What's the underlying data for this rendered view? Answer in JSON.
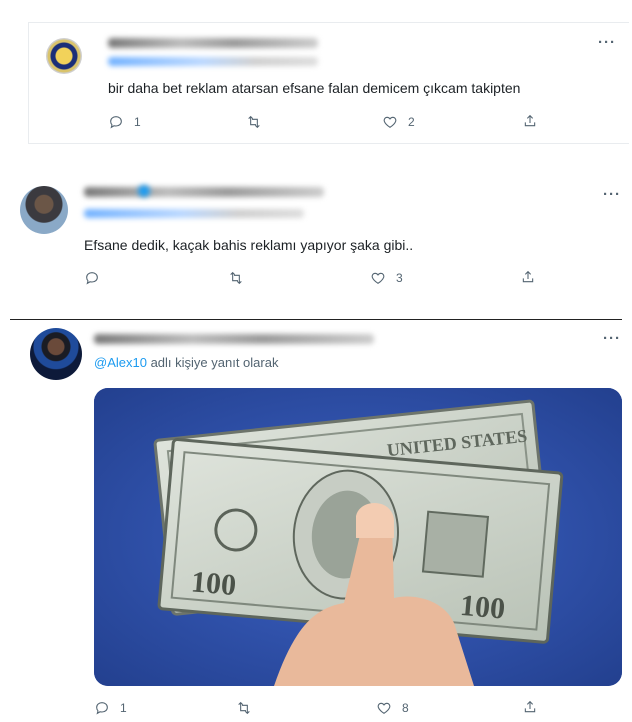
{
  "tweets": [
    {
      "text": "bir daha bet reklam atarsan efsane falan demicem çıkcam takipten",
      "actions": {
        "reply": "1",
        "retweet": "",
        "like": "2"
      }
    },
    {
      "text": "Efsane dedik, kaçak bahis reklamı yapıyor şaka gibi..",
      "actions": {
        "reply": "",
        "retweet": "",
        "like": "3"
      }
    },
    {
      "reply_to": {
        "mention": "@Alex10",
        "suffix": " adlı kişiye yanıt olarak"
      },
      "actions": {
        "reply": "1",
        "retweet": "",
        "like": "8"
      }
    }
  ],
  "more_label": "···",
  "icons": [
    "reply-icon",
    "retweet-icon",
    "like-icon",
    "share-icon",
    "more-icon"
  ],
  "colors": {
    "accent": "#1d9bf0",
    "muted": "#536471",
    "media_bg": "#2f4fa8"
  }
}
